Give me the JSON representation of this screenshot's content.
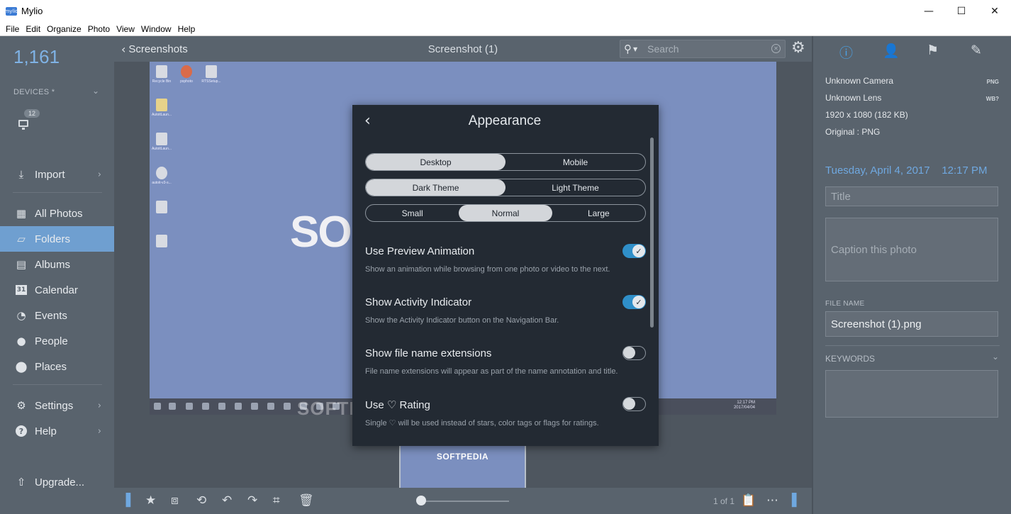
{
  "window": {
    "app_icon_text": "mylio",
    "title": "Mylio",
    "minimize": "—",
    "maximize": "☐",
    "close": "✕"
  },
  "menu": [
    "File",
    "Edit",
    "Organize",
    "Photo",
    "View",
    "Window",
    "Help"
  ],
  "sidebar": {
    "count": "1,161",
    "devices_label": "DEVICES *",
    "device_badge": "12",
    "items": [
      {
        "label": "Import",
        "icon": "import-icon"
      },
      {
        "label": "All Photos",
        "icon": "grid-icon"
      },
      {
        "label": "Folders",
        "icon": "folder-icon",
        "active": true
      },
      {
        "label": "Albums",
        "icon": "album-icon"
      },
      {
        "label": "Calendar",
        "icon": "calendar-icon"
      },
      {
        "label": "Events",
        "icon": "clock-icon"
      },
      {
        "label": "People",
        "icon": "person-icon"
      },
      {
        "label": "Places",
        "icon": "pin-icon"
      },
      {
        "label": "Settings",
        "icon": "gear-icon"
      },
      {
        "label": "Help",
        "icon": "help-icon"
      },
      {
        "label": "Upgrade...",
        "icon": "upgrade-icon"
      }
    ]
  },
  "header": {
    "back_label": "Screenshots",
    "photo_title": "Screenshot (1)",
    "search_placeholder": "Search"
  },
  "photo": {
    "desktop_icons": [
      "Recycle Bin",
      "pxphoto",
      "RTSSetup...",
      "AutoitLaun...",
      "AutoitLaun...",
      "autoit-v3-s...",
      "",
      ""
    ],
    "big_text": "SO",
    "clock": "12:17 PM",
    "date": "2017/04/04",
    "watermark": "SOFTPEDIA",
    "thumb_text": "SOFTPEDIA"
  },
  "toolbar": {
    "page_count": "1 of 1"
  },
  "details": {
    "camera": "Unknown Camera",
    "camera_badge": "PNG",
    "lens": "Unknown Lens",
    "lens_badge": "WB?",
    "resolution": "1920 x 1080 (182 KB)",
    "original": "Original : PNG",
    "date": "Tuesday, April 4, 2017",
    "time": "12:17 PM",
    "title_placeholder": "Title",
    "caption_placeholder": "Caption this photo",
    "file_name_label": "FILE NAME",
    "file_name": "Screenshot (1).png",
    "keywords_label": "KEYWORDS"
  },
  "dialog": {
    "title": "Appearance",
    "platform": {
      "options": [
        "Desktop",
        "Mobile"
      ],
      "selected": "Desktop"
    },
    "theme": {
      "options": [
        "Dark Theme",
        "Light Theme"
      ],
      "selected": "Dark Theme"
    },
    "size": {
      "options": [
        "Small",
        "Normal",
        "Large"
      ],
      "selected": "Normal"
    },
    "settings": [
      {
        "title": "Use Preview Animation",
        "desc": "Show an animation while browsing from one photo or video to the next.",
        "on": true
      },
      {
        "title": "Show Activity Indicator",
        "desc": "Show the Activity Indicator button on the Navigation Bar.",
        "on": true
      },
      {
        "title": "Show file name extensions",
        "desc": "File name extensions will appear as part of the name annotation and title.",
        "on": false
      },
      {
        "title_pre": "Use",
        "title_post": "Rating",
        "desc_pre": "Single",
        "desc_post": "will be used instead of stars, color tags or flags for ratings.",
        "on": false
      }
    ]
  }
}
